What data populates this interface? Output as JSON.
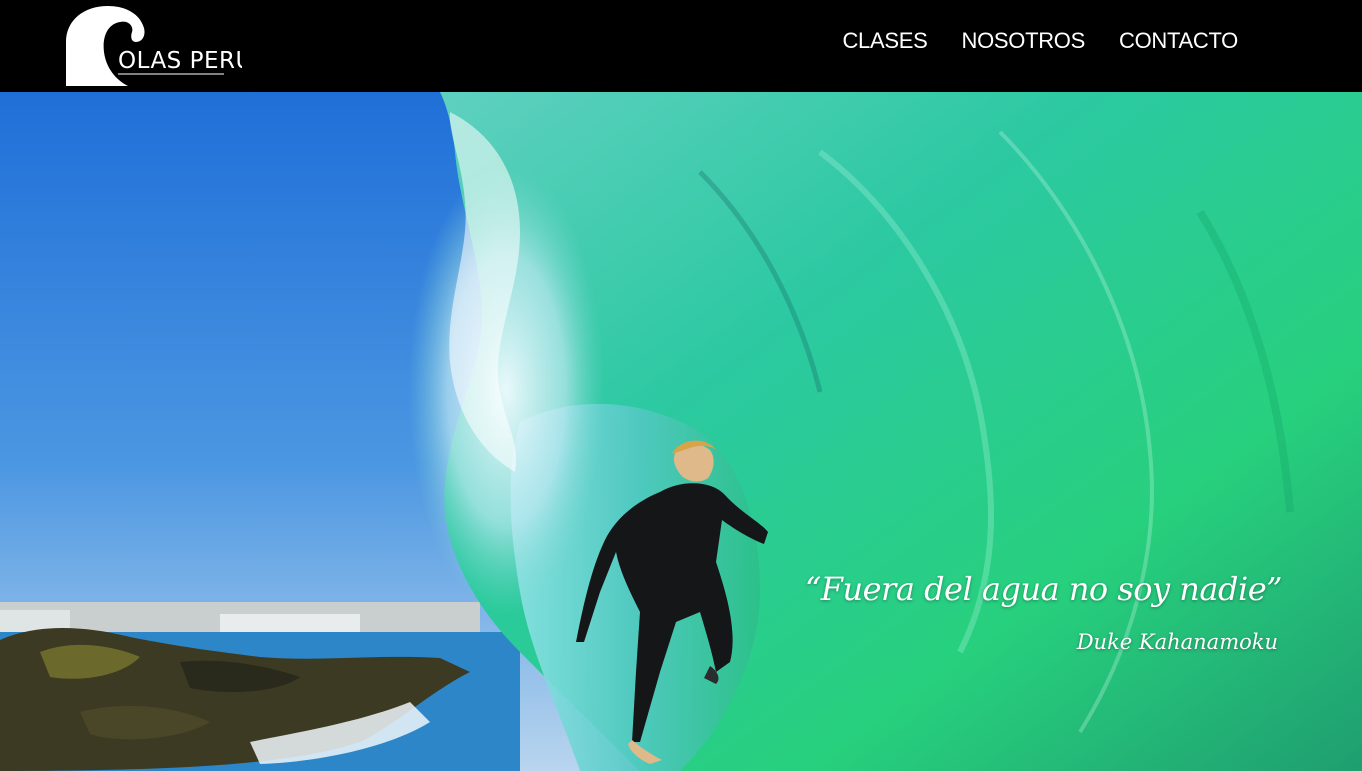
{
  "brand": {
    "name": "OLAS PERU",
    "logo_icon": "wave-icon"
  },
  "nav": {
    "items": [
      {
        "label": "CLASES"
      },
      {
        "label": "NOSOTROS"
      },
      {
        "label": "CONTACTO"
      }
    ]
  },
  "hero": {
    "quote": "“Fuera del agua no soy nadie”",
    "author": "Duke Kahanamoku"
  },
  "colors": {
    "navbar": "#000000",
    "sky": "#2f7fd8",
    "wave": "#2fd49a",
    "text": "#ffffff"
  }
}
